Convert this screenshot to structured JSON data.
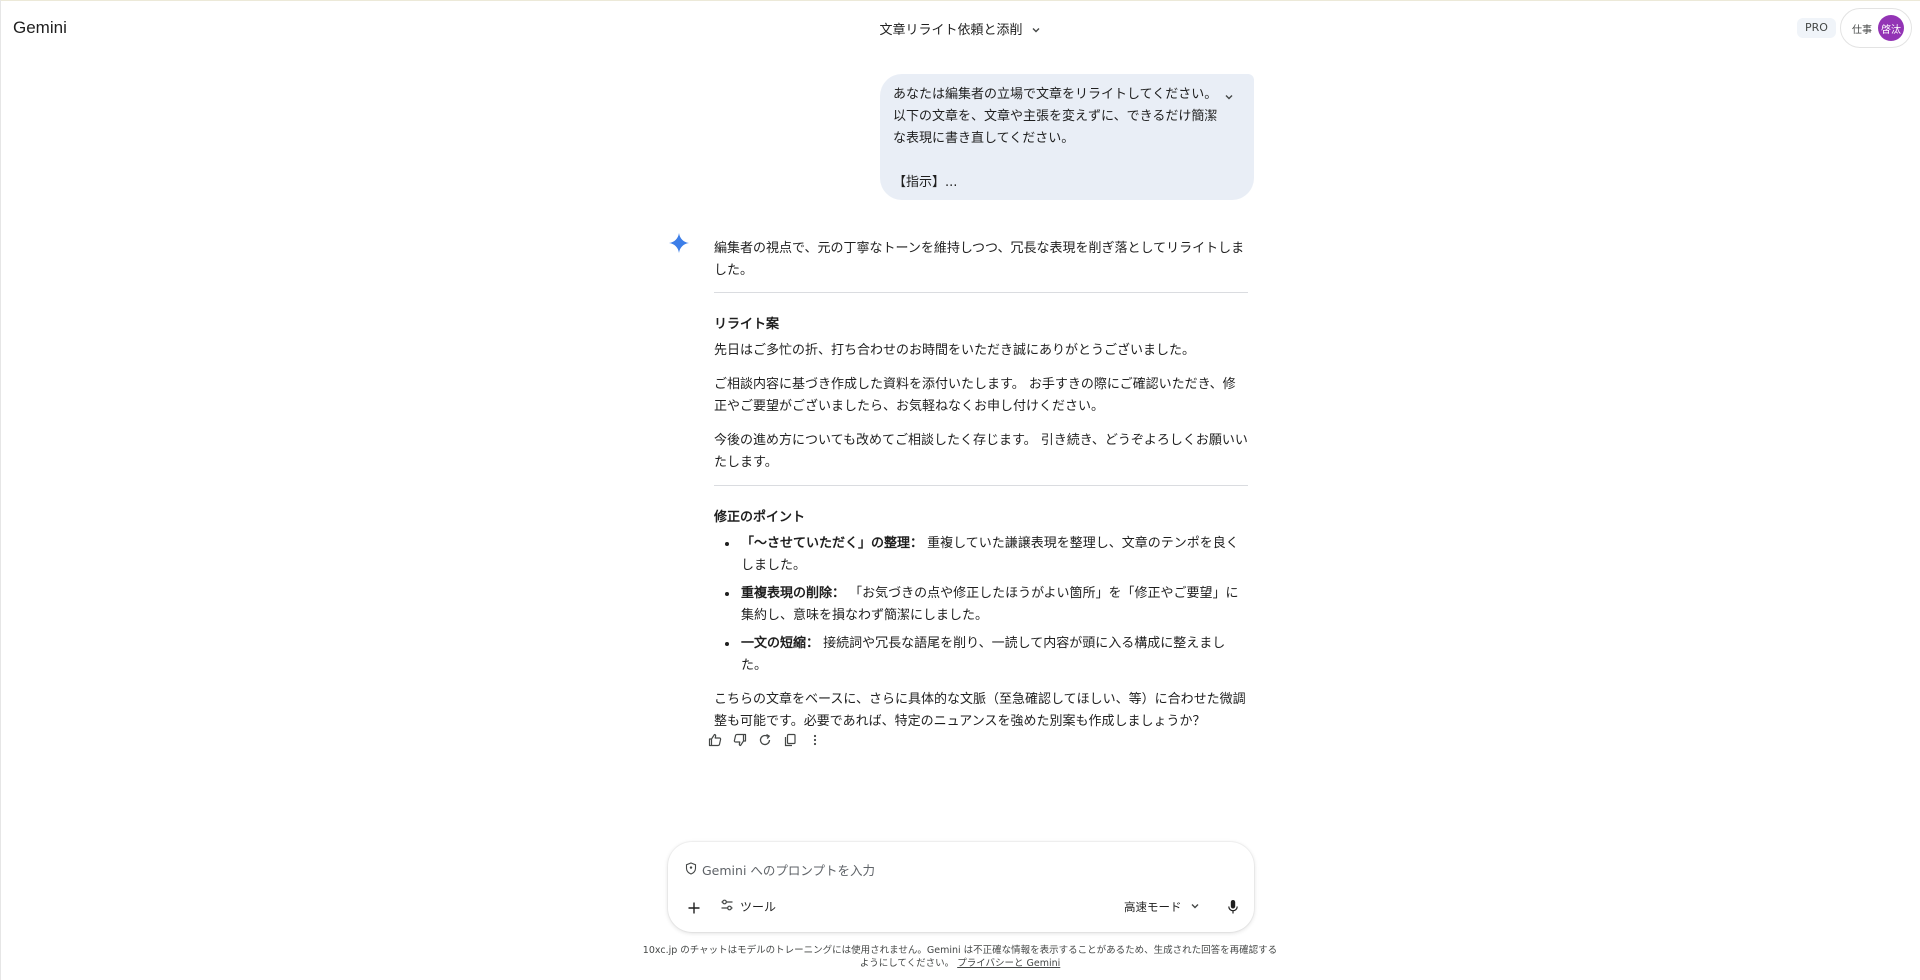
{
  "app": {
    "brand": "Gemini",
    "pro_badge": "PRO"
  },
  "header": {
    "conversation_title": "文章リライト依頼と添削"
  },
  "account": {
    "workspace_label": "仕事",
    "avatar_initials": "啓汰",
    "avatar_color": "#9334b5"
  },
  "user_message": {
    "lines": [
      "あなたは編集者の立場で文章をリライトしてください。",
      "以下の文章を、文章や主張を変えずに、できるだけ簡潔",
      "な表現に書き直してください。",
      "【指示】..."
    ]
  },
  "response": {
    "intro": "編集者の視点で、元の丁寧なトーンを維持しつつ、冗長な表現を削ぎ落としてリライトしました。",
    "rewrite_heading": "リライト案",
    "rewrite_paragraphs": [
      "先日はご多忙の折、打ち合わせのお時間をいただき誠にありがとうございました。",
      "ご相談内容に基づき作成した資料を添付いたします。 お手すきの際にご確認いただき、修正やご要望がございましたら、お気軽ねなくお申し付けください。",
      "今後の進め方についても改めてご相談したく存じます。 引き続き、どうぞよろしくお願いいたします。"
    ],
    "points_heading": "修正のポイント",
    "points": [
      {
        "label": "「〜させていただく」の整理：",
        "text": " 重複していた謙譲表現を整理し、文章のテンポを良くしました。"
      },
      {
        "label": "重複表現の削除：",
        "text": " 「お気づきの点や修正したほうがよい箇所」を「修正やご要望」に集約し、意味を損なわず簡潔にしました。"
      },
      {
        "label": "一文の短縮：",
        "text": " 接続詞や冗長な語尾を削り、一読して内容が頭に入る構成に整えました。"
      }
    ],
    "closing": "こちらの文章をベースに、さらに具体的な文脈（至急確認してほしい、等）に合わせた微調整も可能です。必要であれば、特定のニュアンスを強めた別案も作成しましょうか？",
    "actions": [
      "thumbs-up-icon",
      "thumbs-down-icon",
      "regenerate-icon",
      "copy-icon",
      "more-vert-icon"
    ]
  },
  "composer": {
    "placeholder": "Gemini へのプロンプトを入力",
    "tools_label": "ツール",
    "mode_label": "高速モード"
  },
  "footer": {
    "disclaimer": "10xc.jp のチャットはモデルのトレーニングには使用されません。Gemini は不正確な情報を表示することがあるため、生成された回答を再確認するようにしてください。",
    "privacy_link": "プライバシーと Gemini"
  },
  "colors": {
    "accent": "#1a73e8",
    "bubble": "#e9eef6",
    "avatar": "#9334b5"
  }
}
